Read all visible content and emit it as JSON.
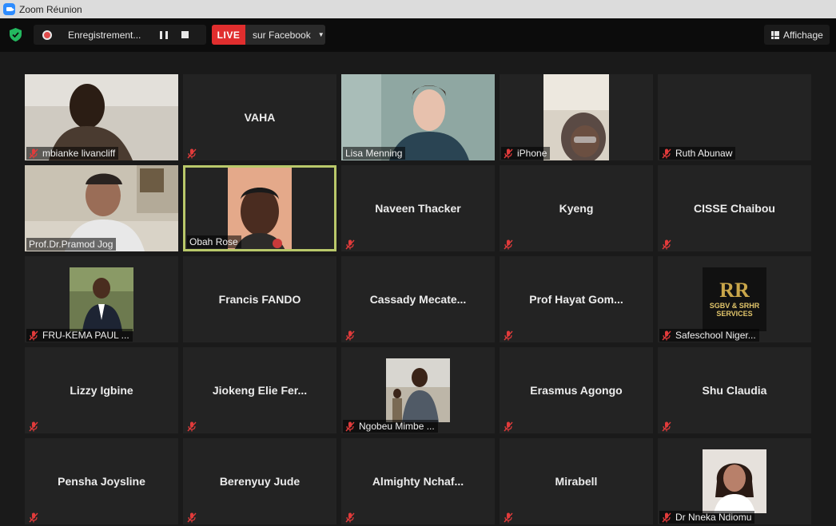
{
  "window": {
    "title": "Zoom Réunion"
  },
  "toolbar": {
    "recording_label": "Enregistrement...",
    "live_badge": "LIVE",
    "live_target": "sur Facebook",
    "view_label": "Affichage"
  },
  "colors": {
    "live_red": "#e02e2e",
    "active_speaker_border": "#b9c86a",
    "mute_red": "#e23b3b",
    "shield_green": "#23b85f"
  },
  "participants": [
    {
      "name": "mbianke livancliff",
      "video": true,
      "muted": true,
      "active": false
    },
    {
      "name": "VAHA",
      "video": false,
      "muted": true,
      "active": false
    },
    {
      "name": "Lisa Menning",
      "video": true,
      "muted": false,
      "active": false
    },
    {
      "name": "iPhone",
      "video": true,
      "muted": true,
      "active": false
    },
    {
      "name": "Ruth Abunaw",
      "video": false,
      "muted": true,
      "active": false,
      "show_label_only": true
    },
    {
      "name": "Prof.Dr.Pramod Jog",
      "video": true,
      "muted": false,
      "active": false
    },
    {
      "name": "Obah Rose",
      "video": true,
      "muted": false,
      "active": true
    },
    {
      "name": "Naveen Thacker",
      "video": false,
      "muted": true,
      "active": false
    },
    {
      "name": "Kyeng",
      "video": false,
      "muted": true,
      "active": false
    },
    {
      "name": "CISSE Chaibou",
      "video": false,
      "muted": true,
      "active": false
    },
    {
      "name": "FRU-KEMA PAUL ...",
      "video": true,
      "muted": true,
      "active": false
    },
    {
      "name": "Francis FANDO",
      "video": false,
      "muted": false,
      "active": false
    },
    {
      "name": "Cassady  Mecate...",
      "video": false,
      "muted": true,
      "active": false
    },
    {
      "name": "Prof  Hayat  Gom...",
      "video": false,
      "muted": true,
      "active": false
    },
    {
      "name": "Safeschool Niger...",
      "video": true,
      "muted": true,
      "active": false,
      "logo_text": "SGBV & SRHR",
      "logo_sub": "SERVICES"
    },
    {
      "name": "Lizzy Igbine",
      "video": false,
      "muted": true,
      "active": false
    },
    {
      "name": "Jiokeng  Elie  Fer...",
      "video": false,
      "muted": true,
      "active": false
    },
    {
      "name": "Ngobeu Mimbe ...",
      "video": true,
      "muted": true,
      "active": false
    },
    {
      "name": "Erasmus Agongo",
      "video": false,
      "muted": true,
      "active": false
    },
    {
      "name": "Shu Claudia",
      "video": false,
      "muted": true,
      "active": false
    },
    {
      "name": "Pensha Joysline",
      "video": false,
      "muted": true,
      "active": false
    },
    {
      "name": "Berenyuy Jude",
      "video": false,
      "muted": true,
      "active": false
    },
    {
      "name": "Almighty  Nchaf...",
      "video": false,
      "muted": true,
      "active": false
    },
    {
      "name": "Mirabell",
      "video": false,
      "muted": true,
      "active": false
    },
    {
      "name": "Dr Nneka Ndiomu",
      "video": true,
      "muted": true,
      "active": false
    }
  ]
}
